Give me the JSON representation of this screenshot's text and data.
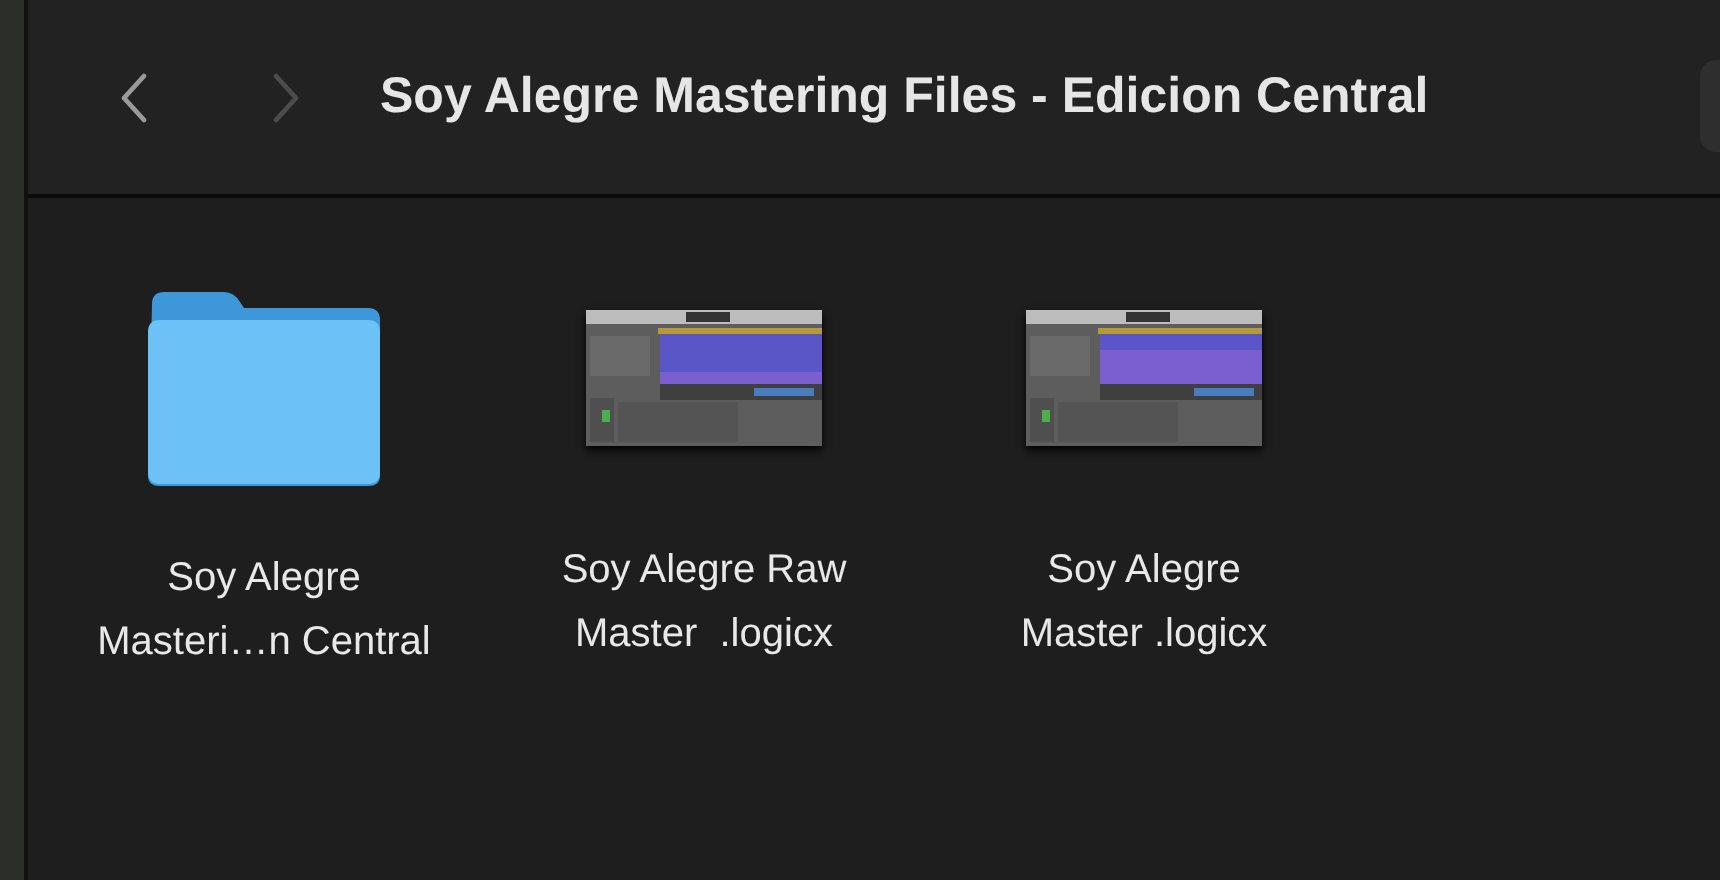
{
  "toolbar": {
    "back": {
      "disabled": false
    },
    "forward": {
      "disabled": true
    },
    "title": "Soy Alegre Mastering Files - Edicion Central"
  },
  "items": [
    {
      "kind": "folder",
      "name_lines": [
        "Soy Alegre",
        "Masteri…n Central"
      ]
    },
    {
      "kind": "document",
      "name_lines": [
        "Soy Alegre Raw",
        "Master  .logicx"
      ]
    },
    {
      "kind": "document",
      "name_lines": [
        "Soy Alegre",
        "Master .logicx"
      ]
    }
  ]
}
